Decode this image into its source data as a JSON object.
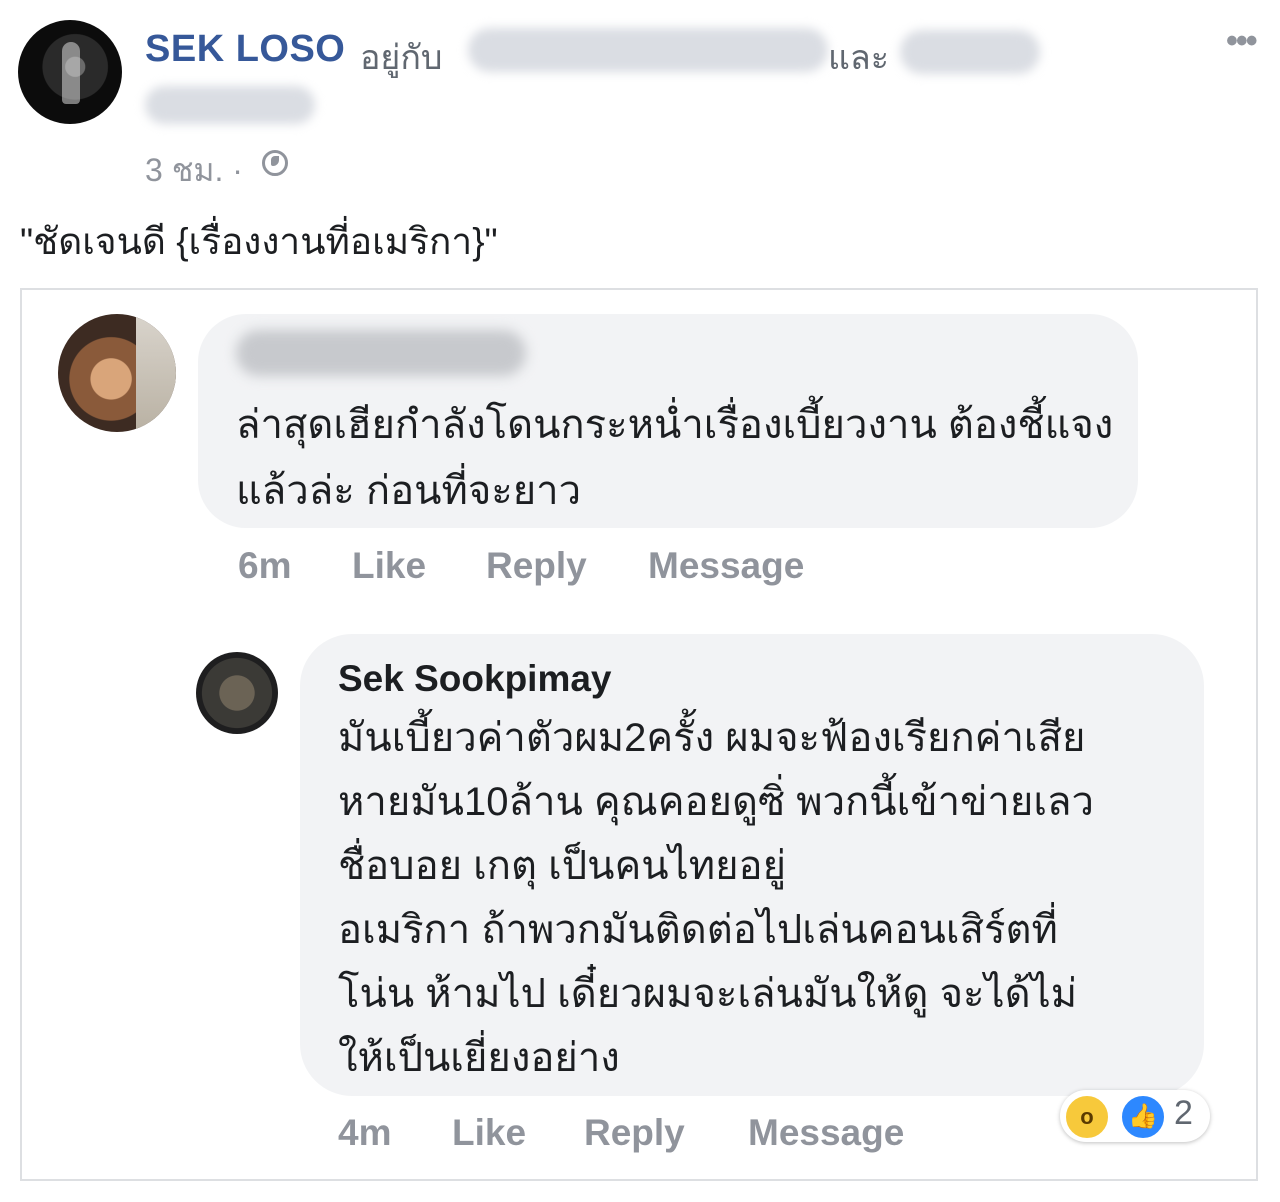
{
  "post": {
    "author": "SEK LOSO",
    "with_label": "อยู่กับ",
    "and_label": "และ",
    "time": "3 ชม. ·",
    "menu_icon": "more-icon",
    "privacy_icon": "globe-icon",
    "text": "\"ชัดเจนดี {เรื่องงานที่อเมริกา}\""
  },
  "comment": {
    "text": "ล่าสุดเฮียกำลังโดนกระหน่ำเรื่องเบี้ยวงาน ต้องชี้แจงแล้วล่ะ ก่อนที่จะยาว",
    "time": "6m",
    "like": "Like",
    "reply": "Reply",
    "message": "Message"
  },
  "reply": {
    "name": "Sek Sookpimay",
    "text": "มันเบี้ยวค่าตัวผม2ครั้ง ผมจะฟ้องเรียกค่าเสีย\nหายมัน10ล้าน คุณคอยดูซิ่ พวกนี้เข้าข่ายเลว\nชื่อบอย เกตุ เป็นคนไทยอยู่\nอเมริกา ถ้าพวกมันติดต่อไปเล่นคอนเสิร์ตที่\nโน่น ห้ามไป เดี๋ยวผมจะเล่นมันให้ดู จะได้ไม่\nให้เป็นเยี่ยงอย่าง",
    "time": "4m",
    "like": "Like",
    "reply": "Reply",
    "message": "Message",
    "reaction_count": "2"
  },
  "colors": {
    "name_blue": "#365899",
    "meta_gray": "#90949c",
    "bubble": "#f2f3f5"
  }
}
